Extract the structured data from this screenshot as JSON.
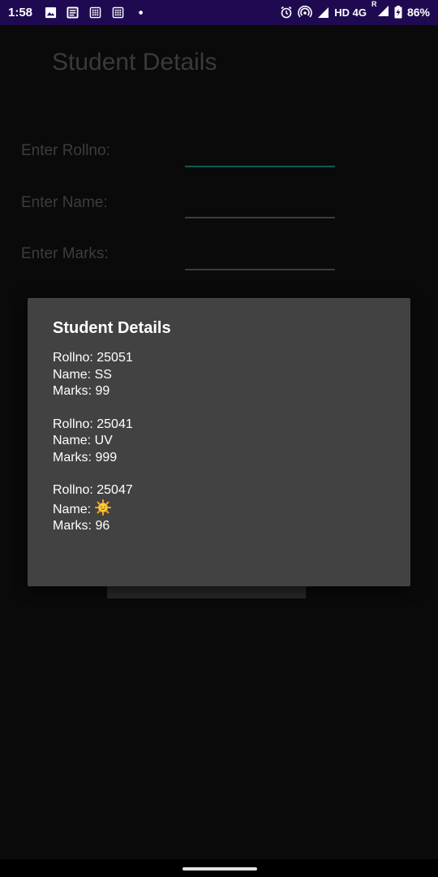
{
  "status_bar": {
    "time": "1:58",
    "network": "HD 4G",
    "roaming": "R",
    "battery": "86%"
  },
  "app": {
    "title": "Student Details",
    "labels": {
      "rollno": "Enter Rollno:",
      "name": "Enter Name:",
      "marks": "Enter Marks:"
    },
    "inputs": {
      "rollno": "",
      "name": "",
      "marks": ""
    }
  },
  "dialog": {
    "title": "Student Details",
    "records": [
      {
        "rollno": "Rollno: 25051",
        "name": "Name: SS",
        "marks": "Marks: 99"
      },
      {
        "rollno": "Rollno: 25041",
        "name": "Name: UV",
        "marks": "Marks: 999"
      },
      {
        "rollno": "Rollno: 25047",
        "name": "Name: ",
        "name_icon": "sun-emoji",
        "marks": "Marks: 96"
      }
    ]
  }
}
